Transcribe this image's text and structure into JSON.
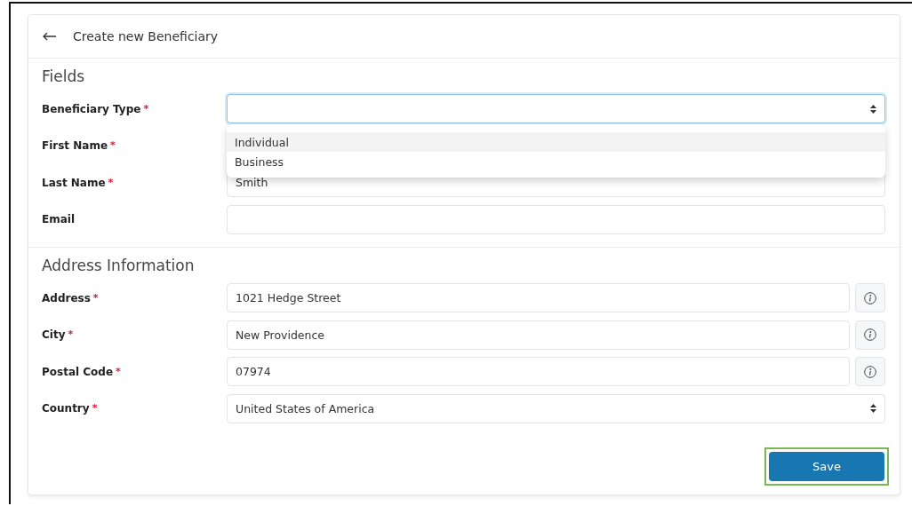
{
  "header": {
    "title": "Create new Beneficiary"
  },
  "sections": [
    {
      "title": "Fields",
      "fields": [
        {
          "label": "Beneficiary Type",
          "required_mark": "*",
          "kind": "select",
          "focused": true,
          "dropdown": [
            {
              "label": "Individual",
              "selected": true
            },
            {
              "label": "Business",
              "selected": false
            }
          ]
        },
        {
          "label": "First Name",
          "required_mark": "*"
        },
        {
          "label": "Last Name",
          "required_mark": "*",
          "kind": "text",
          "value": "Smith"
        },
        {
          "label": "Email",
          "kind": "text"
        }
      ]
    },
    {
      "title": "Address Information",
      "fields": [
        {
          "label": "Address",
          "required_mark": "*",
          "kind": "text",
          "value": "1021 Hedge Street",
          "info": true
        },
        {
          "label": "City",
          "required_mark": "*",
          "kind": "text",
          "value": "New Providence",
          "info": true
        },
        {
          "label": "Postal Code",
          "required_mark": "*",
          "kind": "text",
          "value": "07974",
          "info": true
        },
        {
          "label": "Country",
          "required_mark": "*",
          "kind": "select",
          "value": "United States of America"
        }
      ]
    }
  ],
  "save_button": {
    "label": "Save",
    "highlighted": true
  }
}
